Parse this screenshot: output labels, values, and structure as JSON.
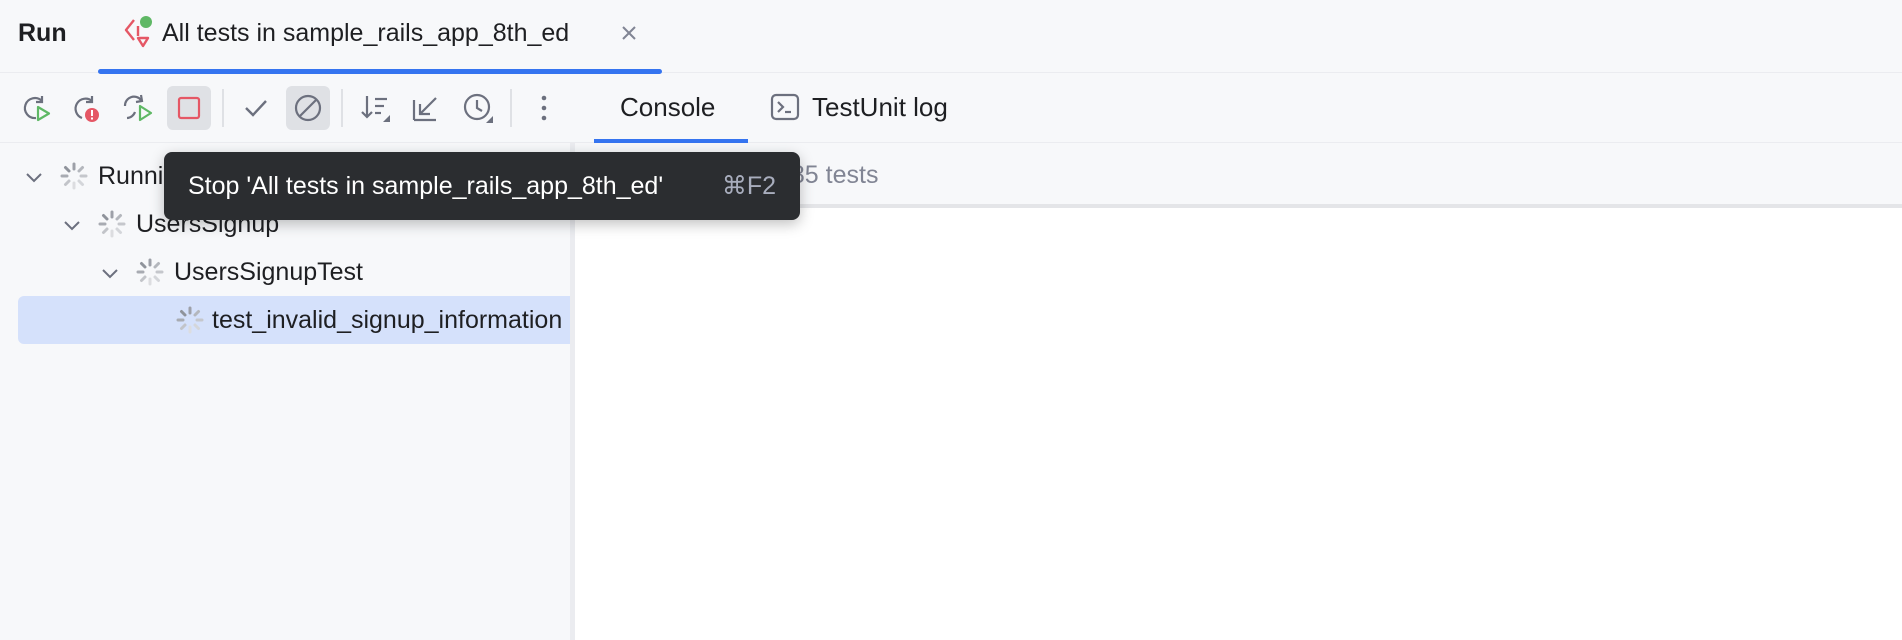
{
  "header": {
    "title": "Run",
    "tab": {
      "label": "All tests in sample_rails_app_8th_ed",
      "icon": "test-run-icon",
      "close_icon": "close-icon"
    }
  },
  "toolbar": {
    "buttons": [
      {
        "name": "rerun-button",
        "icon": "rerun-icon"
      },
      {
        "name": "rerun-failed-button",
        "icon": "rerun-failed-icon"
      },
      {
        "name": "toggle-auto-test-button",
        "icon": "auto-rerun-icon"
      },
      {
        "name": "stop-button",
        "icon": "stop-icon"
      },
      {
        "name": "show-passed-button",
        "icon": "check-icon"
      },
      {
        "name": "show-ignored-button",
        "icon": "ignored-icon"
      },
      {
        "name": "sort-button",
        "icon": "sort-icon"
      },
      {
        "name": "import-tests-button",
        "icon": "import-icon"
      },
      {
        "name": "test-history-button",
        "icon": "history-icon"
      },
      {
        "name": "more-button",
        "icon": "more-vertical-icon"
      }
    ],
    "tabs": [
      {
        "label": "Console",
        "selected": true
      },
      {
        "label": "TestUnit log",
        "icon": "terminal-icon",
        "selected": false
      }
    ]
  },
  "tree": {
    "items": [
      {
        "label": "Running",
        "level": 0,
        "expanded": true
      },
      {
        "label": "UsersSignup",
        "level": 1,
        "expanded": true
      },
      {
        "label": "UsersSignupTest",
        "level": 2,
        "expanded": true
      },
      {
        "label": "test_invalid_signup_information",
        "level": 3,
        "selected": true
      }
    ]
  },
  "console": {
    "status_text": "/ 85 tests"
  },
  "tooltip": {
    "text": "Stop 'All tests in sample_rails_app_8th_ed'",
    "shortcut": "⌘F2"
  },
  "colors": {
    "accent": "#3574f0",
    "stop_red": "#e55765",
    "run_green": "#5fb865",
    "selection": "#d5e1fb",
    "tooltip_bg": "#2b2d30"
  }
}
